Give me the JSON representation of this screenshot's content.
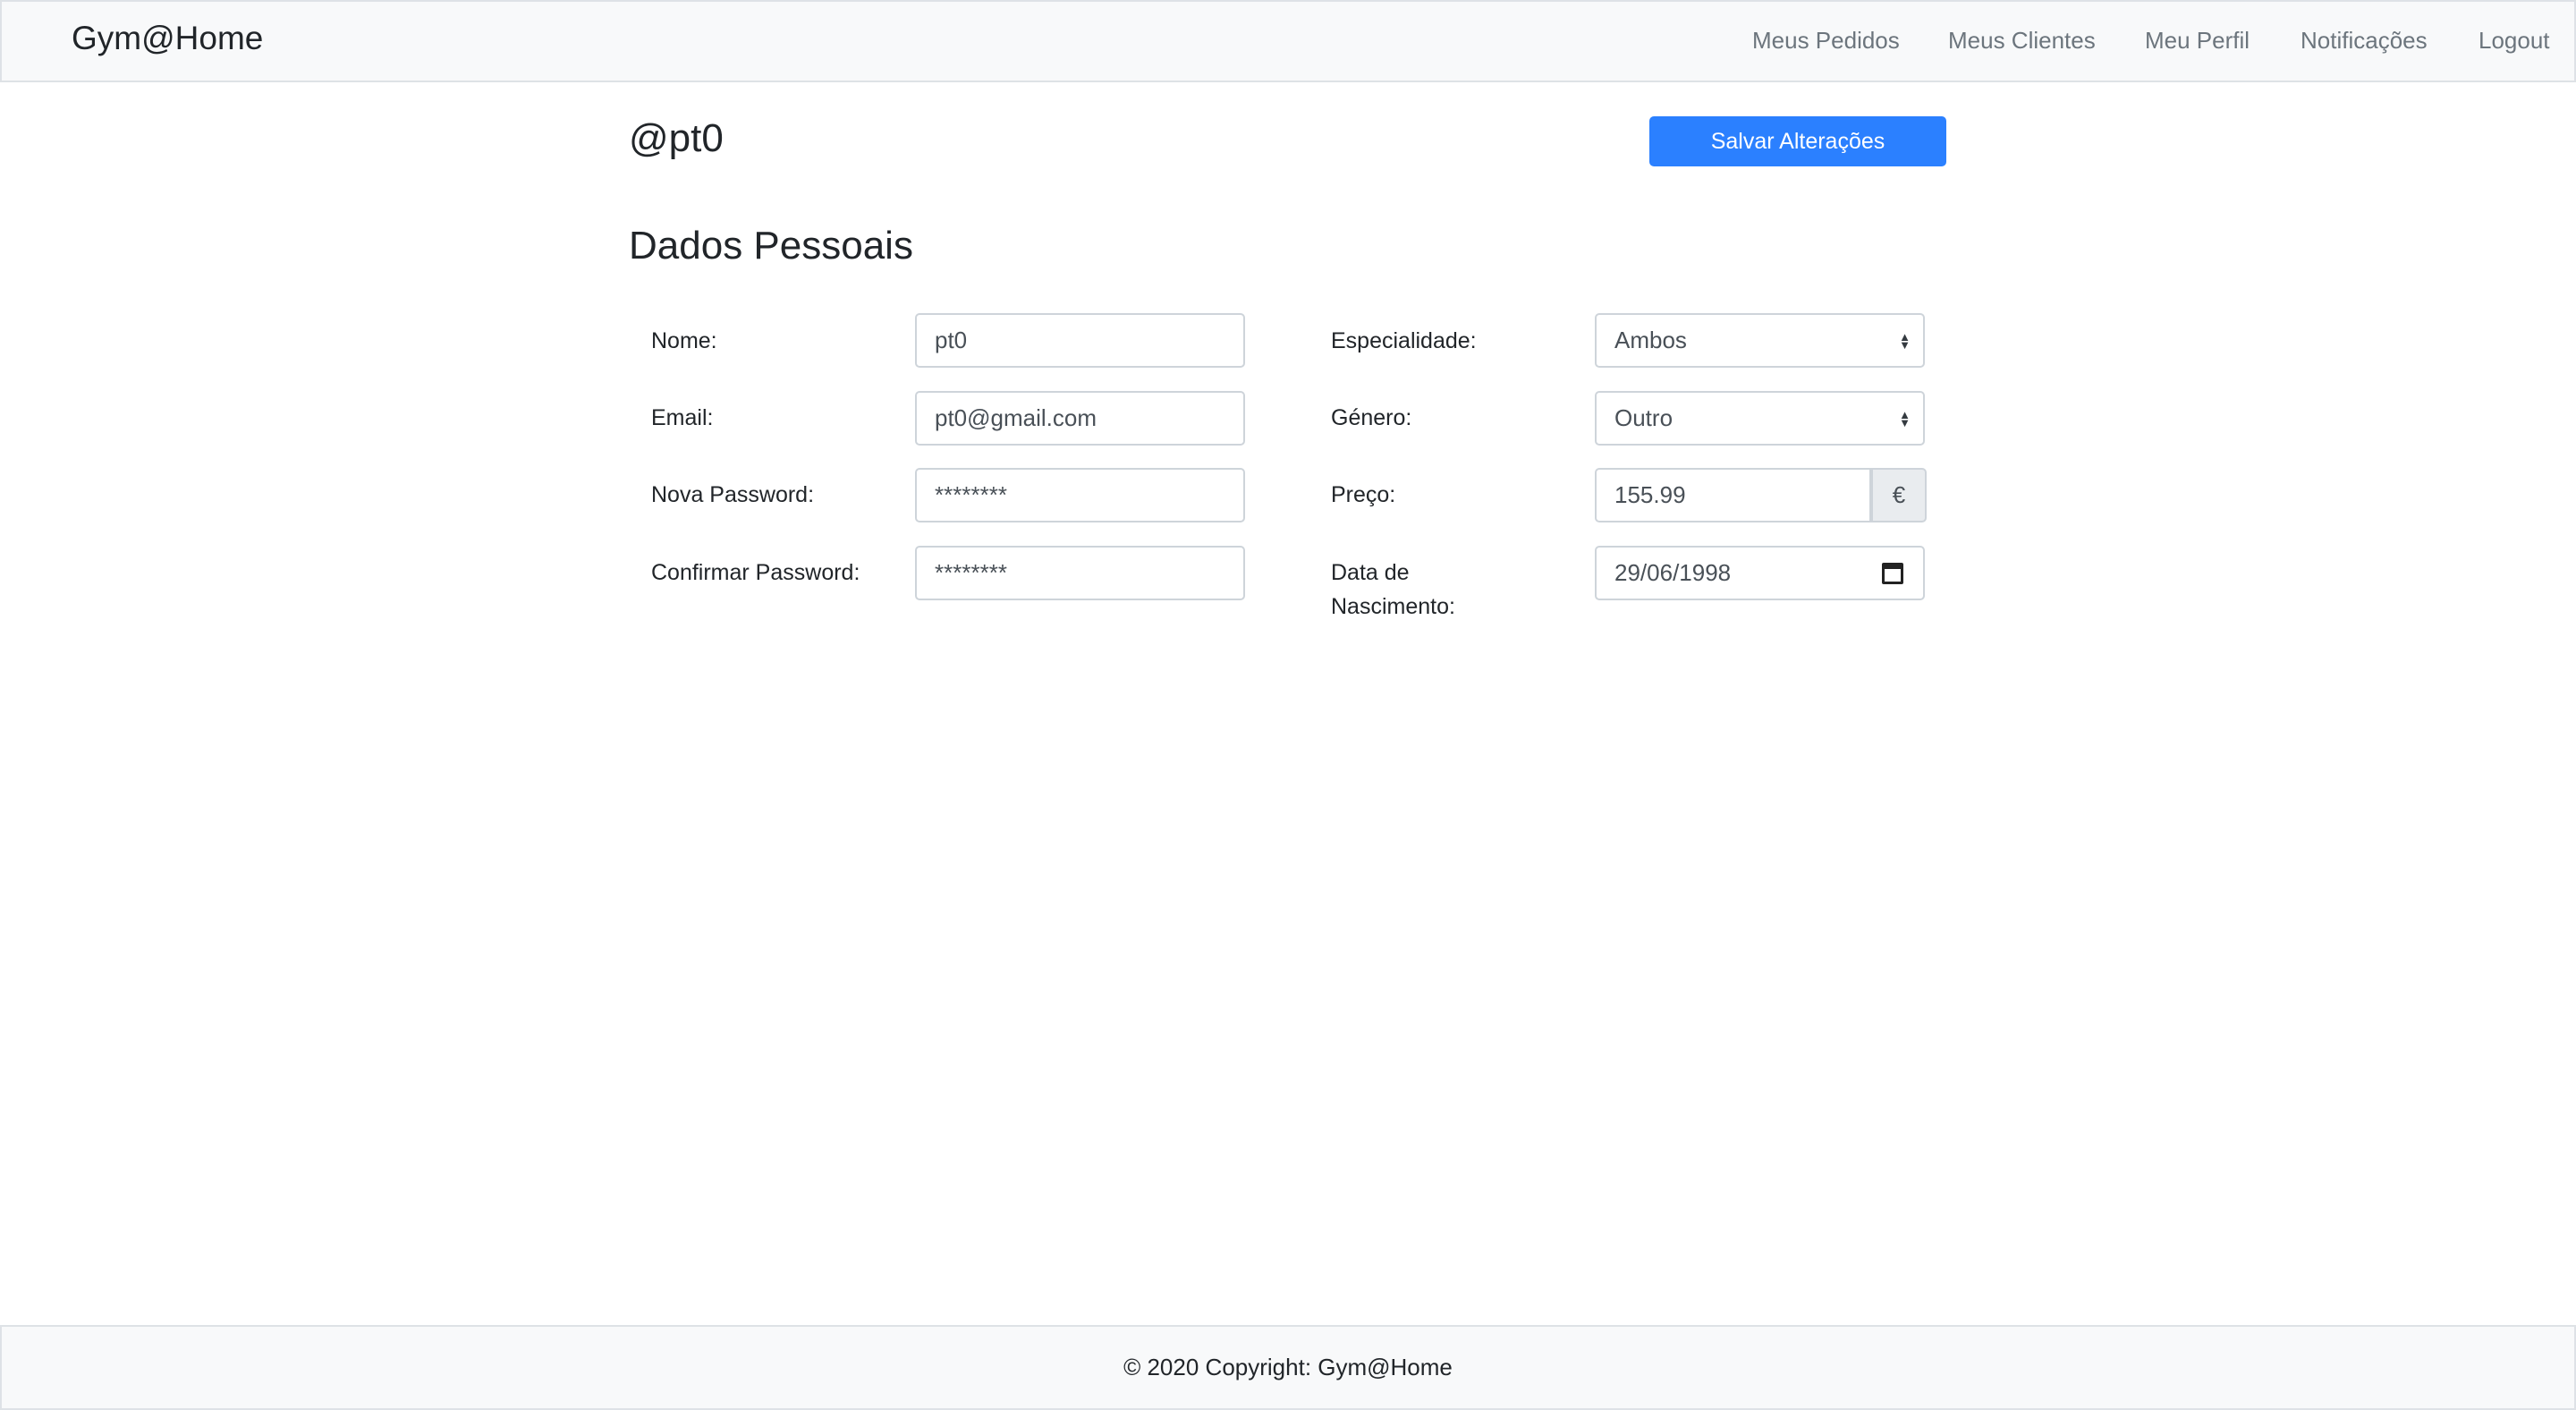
{
  "navbar": {
    "brand": "Gym@Home",
    "links": {
      "pedidos": "Meus Pedidos",
      "clientes": "Meus Clientes",
      "perfil": "Meu Perfil",
      "notificacoes": "Notificações",
      "logout": "Logout"
    }
  },
  "profile": {
    "username": "@pt0",
    "save_label": "Salvar Alterações",
    "section_title": "Dados Pessoais"
  },
  "form": {
    "nome": {
      "label": "Nome:",
      "value": "pt0"
    },
    "email": {
      "label": "Email:",
      "value": "pt0@gmail.com"
    },
    "nova_password": {
      "label": "Nova Password:",
      "value": "********"
    },
    "confirmar_password": {
      "label": "Confirmar Password:",
      "value": "********"
    },
    "especialidade": {
      "label": "Especialidade:",
      "value": "Ambos"
    },
    "genero": {
      "label": "Género:",
      "value": "Outro"
    },
    "preco": {
      "label": "Preço:",
      "value": "155.99",
      "currency": "€"
    },
    "data_nascimento": {
      "label_line1": "Data de",
      "label_line2": "Nascimento:",
      "value": "29/06/1998"
    }
  },
  "footer": {
    "text": "© 2020 Copyright: Gym@Home"
  },
  "colors": {
    "primary": "#2b80ff",
    "navbar_bg": "#f8f9fa",
    "nav_link": "#6c757d"
  }
}
